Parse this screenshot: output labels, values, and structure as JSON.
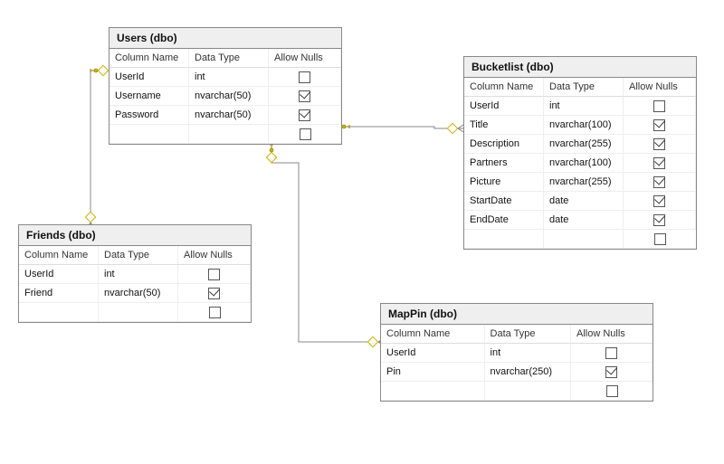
{
  "headers": {
    "col": "Column Name",
    "type": "Data Type",
    "null": "Allow Nulls"
  },
  "tables": {
    "users": {
      "title": "Users (dbo)",
      "rows": [
        {
          "col": "UserId",
          "type": "int",
          "null": false
        },
        {
          "col": "Username",
          "type": "nvarchar(50)",
          "null": true
        },
        {
          "col": "Password",
          "type": "nvarchar(50)",
          "null": true
        }
      ]
    },
    "bucketlist": {
      "title": "Bucketlist (dbo)",
      "rows": [
        {
          "col": "UserId",
          "type": "int",
          "null": false
        },
        {
          "col": "Title",
          "type": "nvarchar(100)",
          "null": true
        },
        {
          "col": "Description",
          "type": "nvarchar(255)",
          "null": true
        },
        {
          "col": "Partners",
          "type": "nvarchar(100)",
          "null": true
        },
        {
          "col": "Picture",
          "type": "nvarchar(255)",
          "null": true
        },
        {
          "col": "StartDate",
          "type": "date",
          "null": true
        },
        {
          "col": "EndDate",
          "type": "date",
          "null": true
        }
      ]
    },
    "friends": {
      "title": "Friends (dbo)",
      "rows": [
        {
          "col": "UserId",
          "type": "int",
          "null": false
        },
        {
          "col": "Friend",
          "type": "nvarchar(50)",
          "null": true
        }
      ]
    },
    "mappin": {
      "title": "MapPin (dbo)",
      "rows": [
        {
          "col": "UserId",
          "type": "int",
          "null": false
        },
        {
          "col": "Pin",
          "type": "nvarchar(250)",
          "null": true
        }
      ]
    }
  },
  "chart_data": {
    "type": "erd",
    "entities": [
      "Users",
      "Bucketlist",
      "Friends",
      "MapPin"
    ],
    "relationships": [
      {
        "from": "Users.UserId",
        "to": "Bucketlist.UserId",
        "type": "one-to-many"
      },
      {
        "from": "Users.UserId",
        "to": "Friends.UserId",
        "type": "one-to-many"
      },
      {
        "from": "Users.UserId",
        "to": "MapPin.UserId",
        "type": "one-to-many"
      }
    ]
  }
}
